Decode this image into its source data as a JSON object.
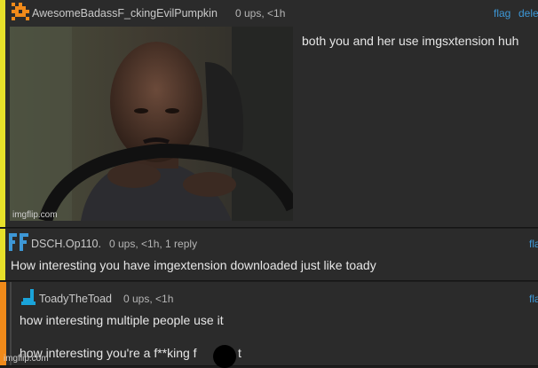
{
  "comments": [
    {
      "username": "AwesomeBadassF_ckingEvilPumpkin",
      "meta": "0 ups, <1h",
      "actions": [
        "flag",
        "delete"
      ],
      "body": "both you and her use imgsxtension huh",
      "image_watermark": "imgflip.com",
      "colors": {
        "bar": "#e7e12a",
        "avatar": "#f08a1a"
      }
    },
    {
      "username": "DSCH.Op110.",
      "meta": "0 ups, <1h, 1 reply",
      "actions": [
        "flag"
      ],
      "body": "How interesting you have imgextension downloaded just like toady",
      "colors": {
        "bar": "#e7e12a",
        "avatar": "#3d97d6"
      }
    },
    {
      "username": "ToadyTheToad",
      "meta": "0 ups, <1h",
      "actions": [
        "flag"
      ],
      "body_lines": [
        "how interesting multiple people use it",
        "how interesting you're a f**king f"
      ],
      "body_tail": "t",
      "colors": {
        "bar": "#f08a1a",
        "avatar": "#1aa3d9"
      }
    }
  ],
  "page_watermark": "imgflip.com"
}
